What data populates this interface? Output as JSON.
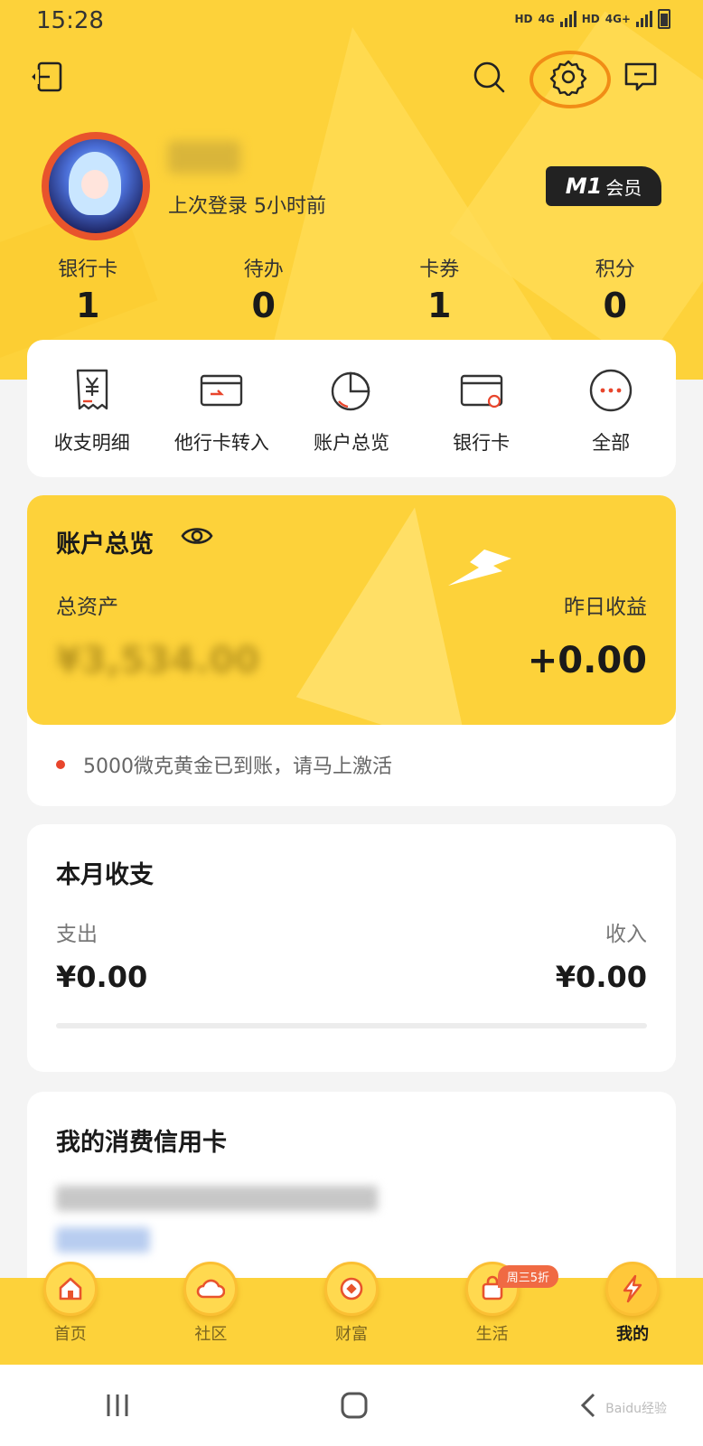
{
  "status_bar": {
    "time": "15:28",
    "network1": "HD",
    "net_type1": "4G",
    "network2": "HD",
    "net_type2": "4G+"
  },
  "profile": {
    "last_login": "上次登录 5小时前",
    "member_level": "M1",
    "member_label": "会员"
  },
  "stats": [
    {
      "label": "银行卡",
      "value": "1"
    },
    {
      "label": "待办",
      "value": "0"
    },
    {
      "label": "卡券",
      "value": "1"
    },
    {
      "label": "积分",
      "value": "0"
    }
  ],
  "quick_actions": [
    {
      "label": "收支明细",
      "icon": "receipt-yen-icon"
    },
    {
      "label": "他行卡转入",
      "icon": "card-transfer-icon"
    },
    {
      "label": "账户总览",
      "icon": "pie-chart-icon"
    },
    {
      "label": "银行卡",
      "icon": "bank-card-icon"
    },
    {
      "label": "全部",
      "icon": "more-dots-icon"
    }
  ],
  "overview": {
    "title": "账户总览",
    "total_assets_label": "总资产",
    "total_assets_value": "¥3,534.00",
    "yesterday_label": "昨日收益",
    "yesterday_value": "+0.00",
    "notice": "5000微克黄金已到账，请马上激活"
  },
  "monthly": {
    "title": "本月收支",
    "expense_label": "支出",
    "expense_value": "¥0.00",
    "income_label": "收入",
    "income_value": "¥0.00"
  },
  "credit": {
    "title": "我的消费信用卡"
  },
  "tabs": [
    {
      "label": "首页",
      "icon": "home-icon"
    },
    {
      "label": "社区",
      "icon": "cloud-icon"
    },
    {
      "label": "财富",
      "icon": "coin-icon"
    },
    {
      "label": "生活",
      "icon": "bag-icon",
      "badge": "周三5折"
    },
    {
      "label": "我的",
      "icon": "lightning-icon",
      "active": true
    }
  ],
  "watermark": "Baidu经验",
  "colors": {
    "brand_yellow": "#fdd23a",
    "highlight_orange": "#f18d16",
    "notice_red": "#e8452c"
  }
}
